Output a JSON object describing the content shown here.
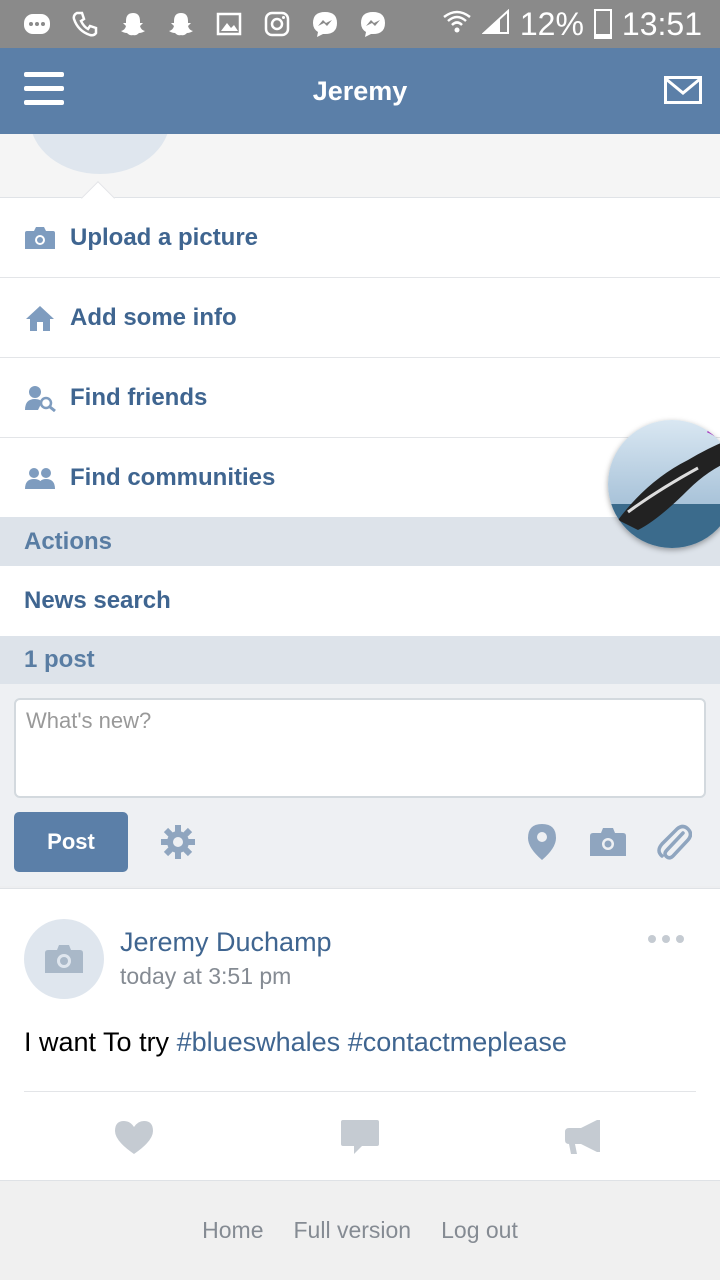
{
  "status_bar": {
    "battery": "12%",
    "time": "13:51",
    "notification_icons": [
      "message-icon",
      "phone-icon",
      "snapchat-icon",
      "snapchat-icon",
      "gallery-icon",
      "instagram-icon",
      "messenger-icon",
      "messenger-icon"
    ]
  },
  "header": {
    "title": "Jeremy"
  },
  "actions_list": [
    {
      "label": "Upload a picture",
      "icon": "camera-icon"
    },
    {
      "label": "Add some info",
      "icon": "home-icon"
    },
    {
      "label": "Find friends",
      "icon": "find-friends-icon"
    },
    {
      "label": "Find communities",
      "icon": "communities-icon"
    }
  ],
  "sections": {
    "actions_header": "Actions",
    "news_search": "News search",
    "posts_count": "1 post"
  },
  "composer": {
    "placeholder": "What's new?",
    "post_button": "Post"
  },
  "post": {
    "author": "Jeremy Duchamp",
    "time": "today at 3:51 pm",
    "text_prefix": "I want To try",
    "hashtags": [
      "#blueswhales",
      "#contactmeplease"
    ]
  },
  "footer": {
    "links": [
      "Home",
      "Full version",
      "Log out"
    ]
  },
  "colors": {
    "header": "#5b7fa8",
    "link": "#3f6590",
    "section_bg": "#dde3ea"
  }
}
